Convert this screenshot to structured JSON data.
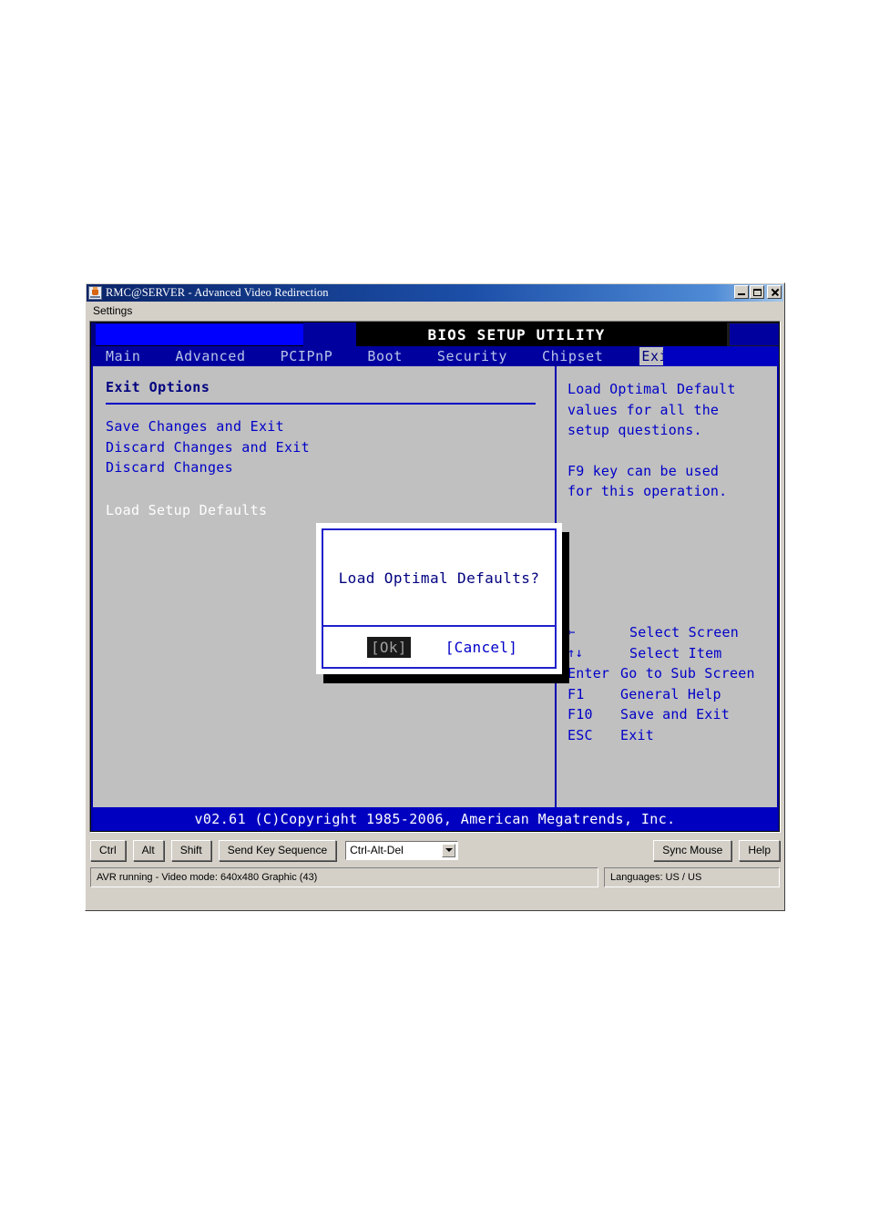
{
  "window": {
    "title": "RMC@SERVER - Advanced Video Redirection",
    "icon": "java-cup-icon",
    "minimize_label": "_",
    "maximize_label": "□",
    "close_label": "×",
    "menu": {
      "settings_label": "Settings"
    }
  },
  "bios": {
    "header_title": "BIOS SETUP UTILITY",
    "tabs": [
      {
        "label": "Main",
        "selected": false
      },
      {
        "label": "Advanced",
        "selected": false
      },
      {
        "label": "PCIPnP",
        "selected": false
      },
      {
        "label": "Boot",
        "selected": false
      },
      {
        "label": "Security",
        "selected": false
      },
      {
        "label": "Chipset",
        "selected": false
      },
      {
        "label": "Exit",
        "selected": true
      }
    ],
    "left_panel": {
      "title": "Exit Options",
      "items": [
        {
          "label": "Save Changes and Exit",
          "highlighted": false
        },
        {
          "label": "Discard Changes and Exit",
          "highlighted": false
        },
        {
          "label": "Discard Changes",
          "highlighted": false
        }
      ],
      "highlighted_item": "Load Setup Defaults"
    },
    "right_panel": {
      "help_paragraph_1": [
        "Load Optimal Default",
        "values for all the",
        "setup questions."
      ],
      "help_paragraph_2": [
        "F9 key can be used",
        "for this operation."
      ],
      "nav_help": [
        {
          "key": "←",
          "desc": "Select Screen"
        },
        {
          "key": "↑↓",
          "desc": "Select Item"
        },
        {
          "key": "Enter",
          "desc": "Go to Sub Screen"
        },
        {
          "key": "F1",
          "desc": "General Help"
        },
        {
          "key": "F10",
          "desc": "Save and Exit"
        },
        {
          "key": "ESC",
          "desc": "Exit"
        }
      ]
    },
    "dialog": {
      "message": "Load Optimal Defaults?",
      "ok_label": "[Ok]",
      "cancel_label": "[Cancel]"
    },
    "footer": "v02.61 (C)Copyright 1985-2006, American Megatrends, Inc."
  },
  "toolbar": {
    "ctrl_label": "Ctrl",
    "alt_label": "Alt",
    "shift_label": "Shift",
    "send_key_sequence_label": "Send Key Sequence",
    "key_sequence_value": "Ctrl-Alt-Del",
    "sync_mouse_label": "Sync Mouse",
    "help_label": "Help"
  },
  "status": {
    "left": "AVR running - Video mode: 640x480 Graphic (43)",
    "right": "Languages: US / US"
  },
  "colors": {
    "bios_blue": "#0000c8",
    "bios_navy": "#00009e",
    "bios_bg": "#c0c0c0",
    "window_chrome": "#d4d0c8",
    "title_gradient_start": "#0a246a"
  }
}
